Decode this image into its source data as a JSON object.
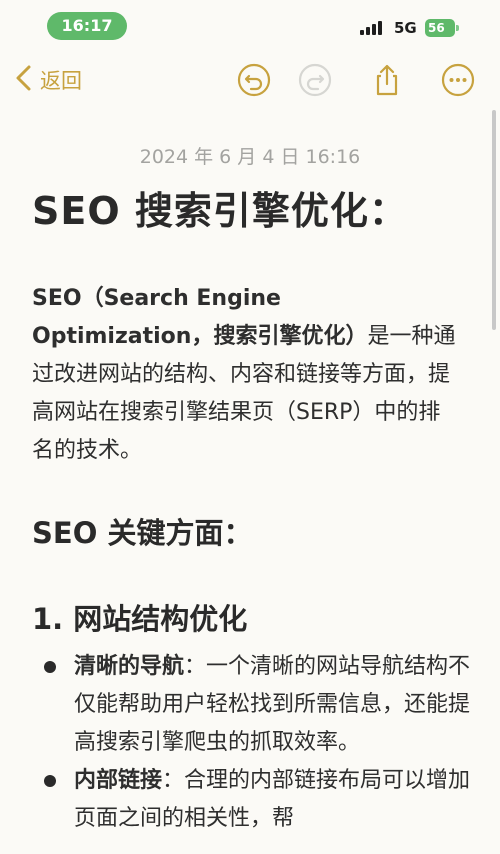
{
  "status_bar": {
    "time": "16:17",
    "network": "5G",
    "battery": "56"
  },
  "toolbar": {
    "back_label": "返回"
  },
  "note": {
    "timestamp": "2024 年 6 月 4 日 16:16",
    "title": "SEO 搜索引擎优化：",
    "intro_bold": "SEO（Search Engine Optimization，搜索引擎优化）",
    "intro_rest": "是一种通过改进网站的结构、内容和链接等方面，提高网站在搜索引擎结果页（SERP）中的排名的技术。",
    "section_key": "SEO 关键方面：",
    "subsection_1": "1. 网站结构优化",
    "bullets": [
      {
        "term": "清晰的导航",
        "sep": "：",
        "text": "一个清晰的网站导航结构不仅能帮助用户轻松找到所需信息，还能提高搜索引擎爬虫的抓取效率。"
      },
      {
        "term": "内部链接",
        "sep": "：",
        "text": "合理的内部链接布局可以增加页面之间的相关性，帮"
      }
    ]
  }
}
